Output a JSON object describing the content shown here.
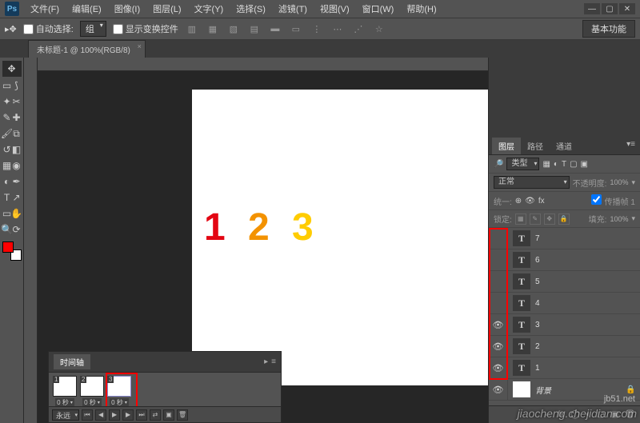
{
  "app": {
    "logo": "Ps"
  },
  "menu": {
    "file": "文件(F)",
    "edit": "编辑(E)",
    "image": "图像(I)",
    "layer": "图层(L)",
    "type": "文字(Y)",
    "select": "选择(S)",
    "filter": "滤镜(T)",
    "view": "视图(V)",
    "window": "窗口(W)",
    "help": "帮助(H)"
  },
  "options": {
    "autoselect_label": "自动选择:",
    "autoselect_value": "组",
    "transform_label": "显示变换控件",
    "essentials": "基本功能"
  },
  "doc": {
    "tab": "未标题-1 @ 100%(RGB/8)"
  },
  "canvas": {
    "n1": "1",
    "n2": "2",
    "n3": "3"
  },
  "panel": {
    "tabs": {
      "layers": "图层",
      "paths": "路径",
      "channels": "通道"
    },
    "kind": "类型",
    "blend": "正常",
    "opacity_label": "不透明度:",
    "opacity_value": "100%",
    "unify": "统一:",
    "propagate": "传播帧 1",
    "lock_label": "锁定:",
    "fill_label": "填充:",
    "fill_value": "100%",
    "layers": [
      {
        "name": "7",
        "visible": false,
        "type": "T"
      },
      {
        "name": "6",
        "visible": false,
        "type": "T"
      },
      {
        "name": "5",
        "visible": false,
        "type": "T"
      },
      {
        "name": "4",
        "visible": false,
        "type": "T"
      },
      {
        "name": "3",
        "visible": true,
        "type": "T"
      },
      {
        "name": "2",
        "visible": true,
        "type": "T"
      },
      {
        "name": "1",
        "visible": true,
        "type": "T"
      }
    ],
    "bg_layer": {
      "name": "背景",
      "visible": true,
      "locked": true
    }
  },
  "timeline": {
    "title": "时间轴",
    "frames": [
      {
        "no": "1",
        "dur": "0 秒"
      },
      {
        "no": "2",
        "dur": "0 秒"
      },
      {
        "no": "3",
        "dur": "0 秒"
      }
    ],
    "loop": "永远"
  },
  "watermark": {
    "site": "jb51.net",
    "sub": "jiaocheng.chejidian.com"
  }
}
